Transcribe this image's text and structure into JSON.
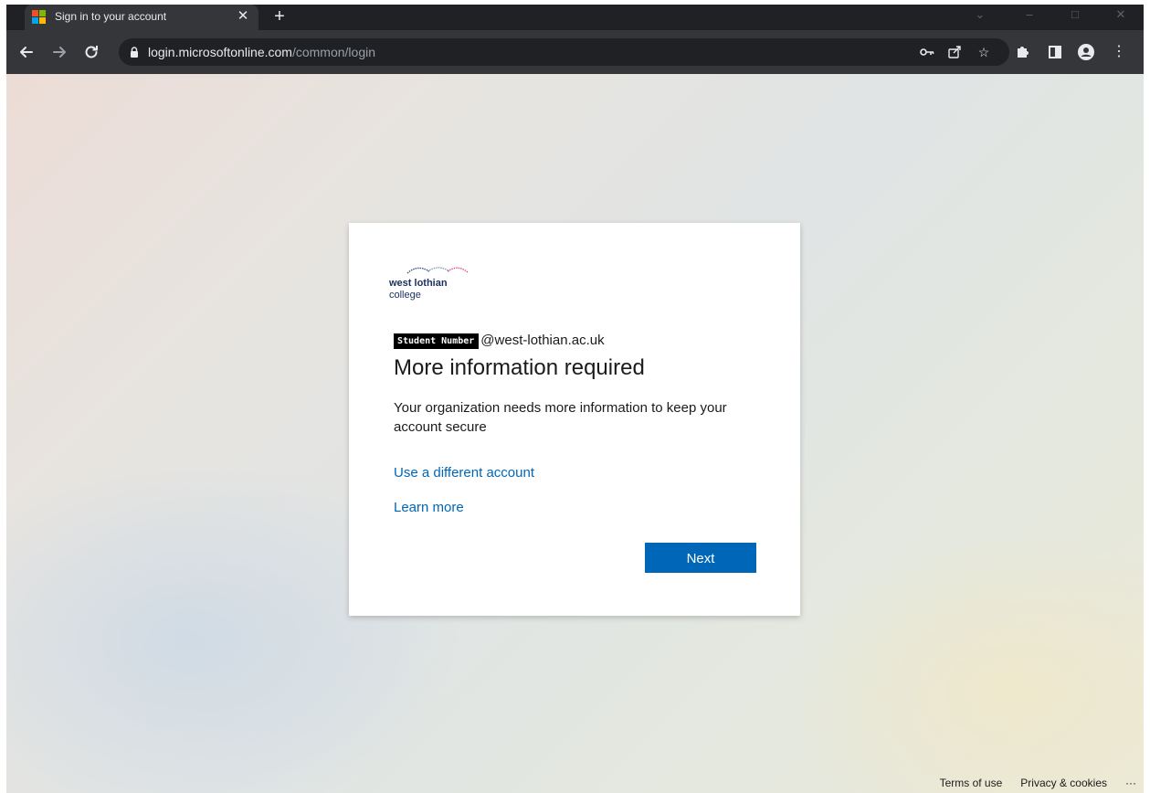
{
  "browser": {
    "tab_title": "Sign in to your account",
    "tab_close": "✕",
    "new_tab": "+",
    "url_host": "login.microsoftonline.com",
    "url_path": "/common/login"
  },
  "logo": {
    "line1": "west lothian",
    "line2": "college"
  },
  "card": {
    "redacted_label": "Student Number",
    "identity_suffix": "@west-lothian.ac.uk",
    "title": "More information required",
    "description": "Your organization needs more information to keep your account secure",
    "link_different_account": "Use a different account",
    "link_learn_more": "Learn more",
    "next_label": "Next"
  },
  "footer": {
    "terms": "Terms of use",
    "privacy": "Privacy & cookies",
    "more": "···"
  },
  "colors": {
    "accent": "#0067b8",
    "chrome_dark": "#202124",
    "chrome_toolbar": "#35363a"
  }
}
